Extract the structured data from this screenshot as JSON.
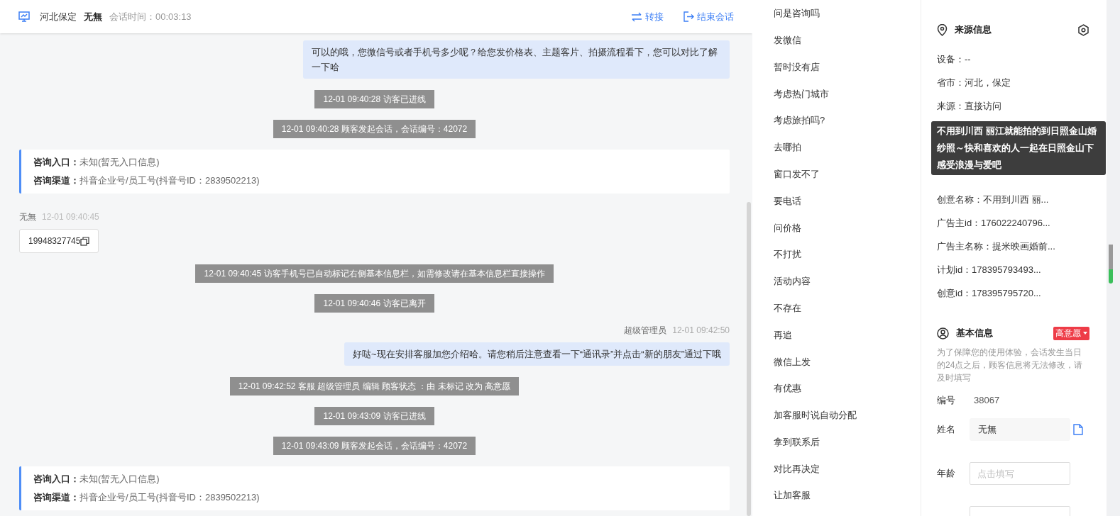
{
  "header": {
    "location": "河北保定",
    "visitor": "无無",
    "duration": "会话时间：00:03:13",
    "actions": [
      {
        "kind": "transfer",
        "label": "转接"
      },
      {
        "kind": "end",
        "label": "结束会话"
      }
    ]
  },
  "messages": [
    {
      "kind": "agent",
      "text": "可以的哦，您微信号或者手机号多少呢？给您发价格表、主题客片、拍摄流程看下，您可以对比了解一下哈"
    },
    {
      "kind": "system",
      "text": "12-01 09:40:28 访客已进线"
    },
    {
      "kind": "system",
      "text": "12-01 09:40:28 顾客发起会话，会话编号：42072"
    },
    {
      "kind": "info_card",
      "lines": [
        "**咨询入口：**未知(暂无入口信息)",
        "**咨询渠道：**抖音企业号/员工号(抖音号ID：2839502213)"
      ]
    },
    {
      "kind": "visitor",
      "sender": "无無",
      "time": "12-01 09:40:45",
      "text": "19948327745"
    },
    {
      "kind": "system",
      "text": "12-01 09:40:45 访客手机号已自动标记右侧基本信息栏，如需修改请在基本信息栏直接操作"
    },
    {
      "kind": "system",
      "text": "12-01 09:40:46 访客已离开"
    },
    {
      "kind": "agent",
      "sender": "超级管理员",
      "time": "12-01 09:42:50",
      "text": "好哒~现在安排客服加您介绍哈。请您稍后注意查看一下“通讯录”并点击“新的朋友”通过下哦"
    },
    {
      "kind": "system",
      "text": "12-01 09:42:52 客服 超级管理员 编辑 顾客状态 ：由 未标记 改为 高意愿"
    },
    {
      "kind": "system",
      "text": "12-01 09:43:09 访客已进线"
    },
    {
      "kind": "system",
      "text": "12-01 09:43:09 顾客发起会话，会话编号：42072"
    },
    {
      "kind": "info_card",
      "lines": [
        "**咨询入口：**未知(暂无入口信息)",
        "**咨询渠道：**抖音企业号/员工号(抖音号ID：2839502213)"
      ]
    }
  ],
  "quick_replies": [
    "问是咨询吗",
    "发微信",
    "暂时没有店",
    "考虑热门城市",
    "考虑旅拍吗?",
    "去哪拍",
    "窗口发不了",
    "要电话",
    "问价格",
    "不打扰",
    "活动内容",
    "不存在",
    "再追",
    "微信上发",
    "有优惠",
    "加客服时说自动分配",
    "拿到联系后",
    "对比再决定",
    "让加客服"
  ],
  "source_info": {
    "title": "来源信息",
    "items_top": [
      "设备：--",
      "省市：河北，保定",
      "来源：直接访问"
    ],
    "tooltip": "不用到川西 丽江就能拍的到日照金山婚纱照～快和喜欢的人一起在日照金山下感受浪漫与爱吧",
    "items_bottom": [
      "创意名称：不用到川西 丽...",
      "广告主id：176022240796...",
      "广告主名称：提米映画婚前...",
      "计划id：178395793493...",
      "创意id：178395795720..."
    ]
  },
  "basic_info": {
    "title": "基本信息",
    "status": "高意愿",
    "note": "为了保障您的使用体验，会话发生当日的24点之后，顾客信息将无法修改，请及时填写",
    "fields": [
      {
        "kind": "text",
        "label": "编号",
        "value": "38067"
      },
      {
        "kind": "copyable",
        "label": "姓名",
        "value": "无無"
      },
      {
        "kind": "input",
        "label": "年龄",
        "placeholder": "点击填写"
      },
      {
        "kind": "input"
      }
    ]
  }
}
